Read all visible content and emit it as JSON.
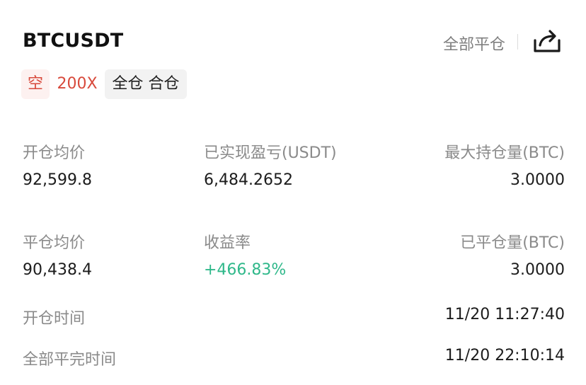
{
  "header": {
    "symbol": "BTCUSDT",
    "close_all_label": "全部平仓",
    "share_icon": "share-icon"
  },
  "tags": {
    "side": "空",
    "leverage": "200X",
    "margin_mode": "全仓 合仓"
  },
  "colors": {
    "short_red": "#d84a3c",
    "profit_green": "#2fb88a",
    "label_gray": "#8a8a8a"
  },
  "stats": {
    "open_avg_price": {
      "label": "开仓均价",
      "value": "92,599.8"
    },
    "realized_pnl": {
      "label": "已实现盈亏(USDT)",
      "value": "6,484.2652"
    },
    "max_position": {
      "label": "最大持仓量(BTC)",
      "value": "3.0000"
    },
    "close_avg_price": {
      "label": "平仓均价",
      "value": "90,438.4"
    },
    "roi": {
      "label": "收益率",
      "value": "+466.83%"
    },
    "closed_position": {
      "label": "已平仓量(BTC)",
      "value": "3.0000"
    },
    "open_time": {
      "label": "开仓时间",
      "value": "11/20 11:27:40"
    },
    "full_close_time": {
      "label": "全部平完时间",
      "value": "11/20 22:10:14"
    }
  }
}
